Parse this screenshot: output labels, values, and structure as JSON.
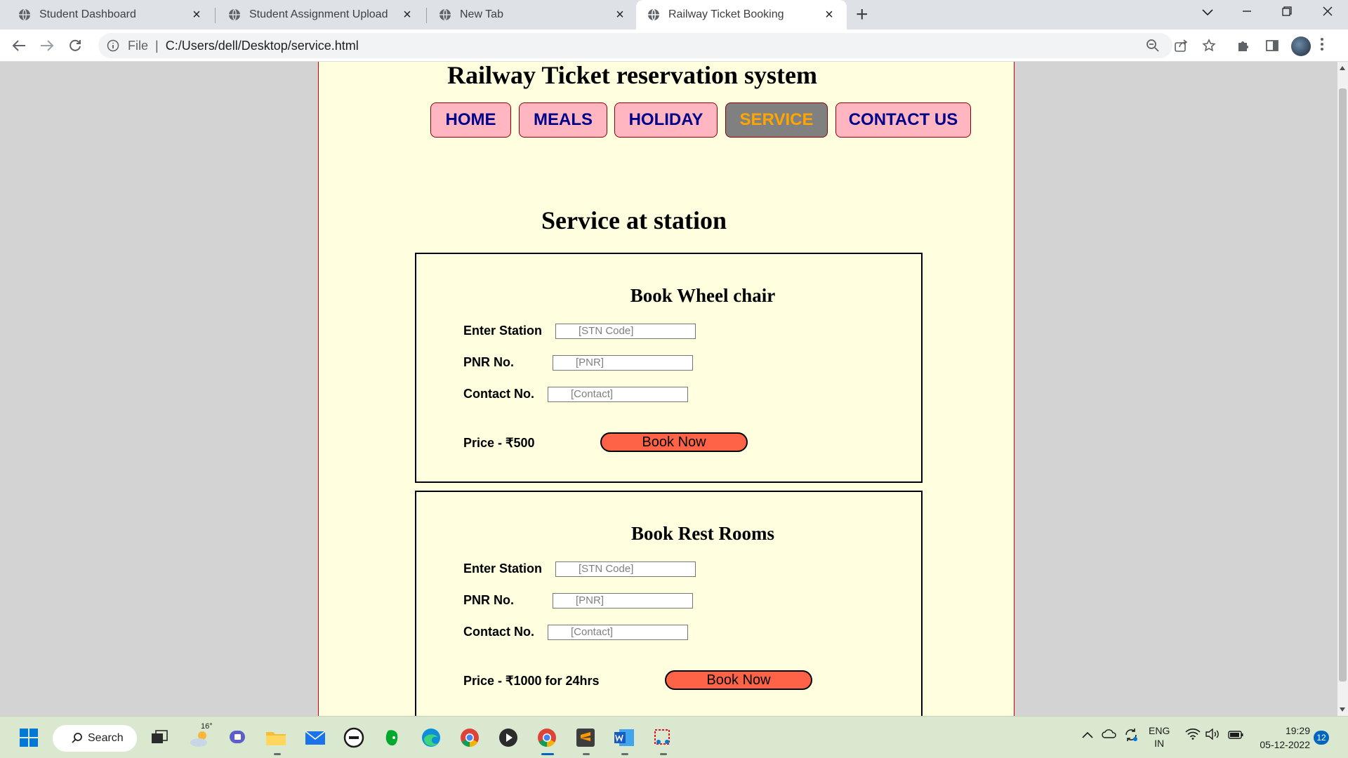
{
  "browser": {
    "tabs": [
      {
        "title": "Student Dashboard",
        "active": false
      },
      {
        "title": "Student Assignment Upload",
        "active": false
      },
      {
        "title": "New Tab",
        "active": false
      },
      {
        "title": "Railway Ticket Booking",
        "active": true
      }
    ],
    "close_glyph": "×",
    "new_tab_glyph": "+",
    "address": {
      "scheme_label": "File",
      "separator": "|",
      "url": "C:/Users/dell/Desktop/service.html"
    }
  },
  "page": {
    "site_title": "Railway Ticket reservation system",
    "nav": [
      {
        "label": "HOME",
        "active": false
      },
      {
        "label": "MEALS",
        "active": false
      },
      {
        "label": "HOLIDAY",
        "active": false
      },
      {
        "label": "SERVICE",
        "active": true
      },
      {
        "label": "CONTACT US",
        "active": false
      }
    ],
    "section_heading": "Service at station",
    "cards": [
      {
        "title": "Book Wheel chair",
        "fields": [
          {
            "label": "Enter Station",
            "placeholder": "[STN Code]"
          },
          {
            "label": "PNR No.",
            "placeholder": "[PNR]"
          },
          {
            "label": "Contact No.",
            "placeholder": "[Contact]"
          }
        ],
        "price": "Price - ₹500",
        "button": "Book Now"
      },
      {
        "title": "Book Rest Rooms",
        "fields": [
          {
            "label": "Enter Station",
            "placeholder": "[STN Code]"
          },
          {
            "label": "PNR No.",
            "placeholder": "[PNR]"
          },
          {
            "label": "Contact No.",
            "placeholder": "[Contact]"
          }
        ],
        "price": "Price - ₹1000 for 24hrs",
        "button": "Book Now"
      }
    ],
    "colors": {
      "page_bg": "#ffffe0",
      "nav_bg": "#ffb6c1",
      "nav_text": "#00008b",
      "nav_active_bg": "#808080",
      "nav_active_text": "#ffa500",
      "button_bg": "#ff6347",
      "page_border": "#cc0000"
    }
  },
  "taskbar": {
    "search_label": "Search",
    "weather_temp": "16°",
    "language": {
      "line1": "ENG",
      "line2": "IN"
    },
    "time": "19:29",
    "date": "05-12-2022",
    "notification_count": "12"
  }
}
